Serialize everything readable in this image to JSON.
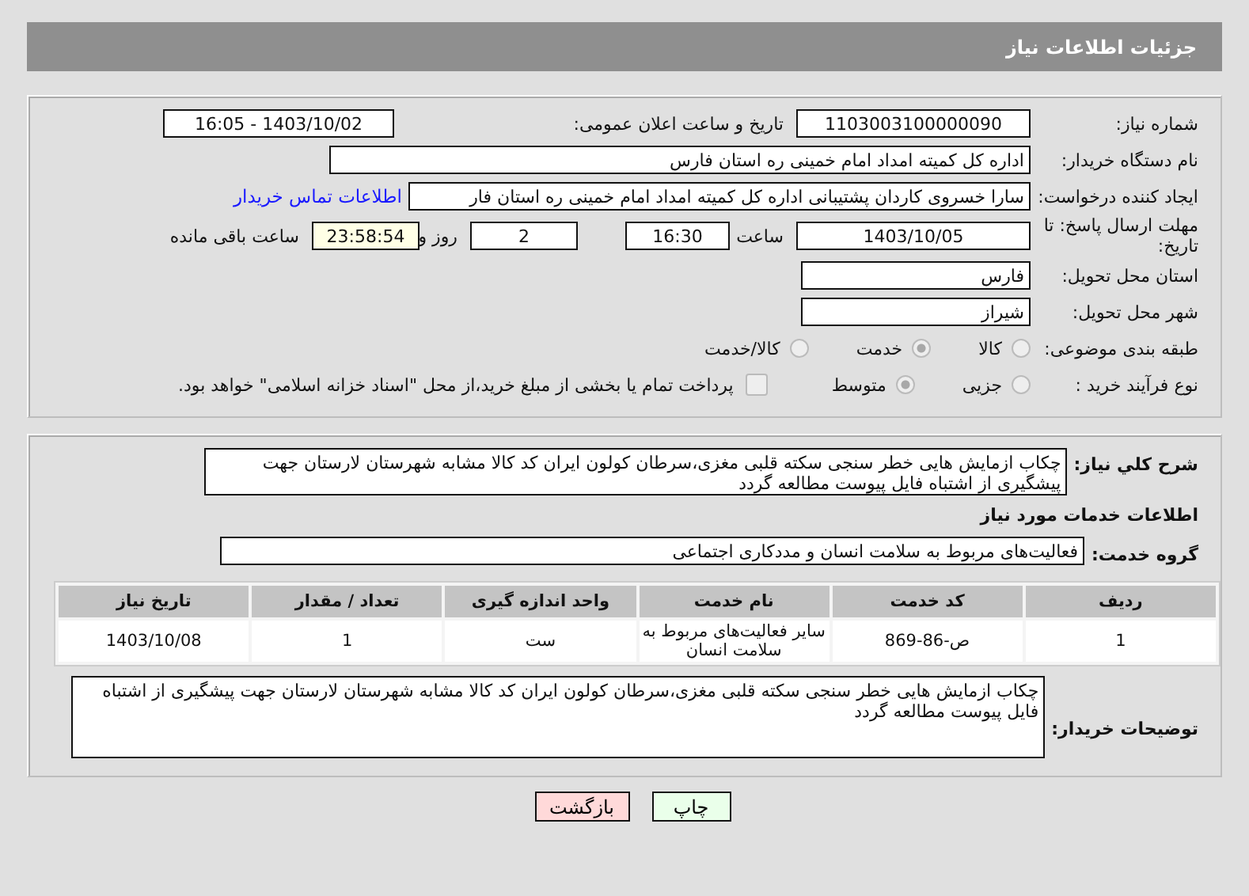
{
  "header": {
    "title": "جزئیات اطلاعات نیاز"
  },
  "need_number": {
    "label": "شماره نیاز:",
    "value": "1103003100000090"
  },
  "announce_datetime": {
    "label": "تاریخ و ساعت اعلان عمومی:",
    "value": "1403/10/02 - 16:05"
  },
  "buyer_org": {
    "label": "نام دستگاه خریدار:",
    "value": "اداره کل کمیته امداد امام خمینی  ره  استان فارس"
  },
  "requester": {
    "label": "ایجاد کننده درخواست:",
    "value": "سارا خسروی کاردان پشتیبانی  اداره کل کمیته امداد امام خمینی  ره  استان فار",
    "link": "اطلاعات تماس خریدار"
  },
  "deadline": {
    "label": "مهلت ارسال پاسخ: تا تاریخ:",
    "date": "1403/10/05",
    "time_label": "ساعت",
    "time": "16:30",
    "days": "2",
    "days_label": "روز و",
    "remaining": "23:58:54",
    "remaining_label": "ساعت باقی مانده"
  },
  "delivery_province": {
    "label": "استان محل تحویل:",
    "value": "فارس"
  },
  "delivery_city": {
    "label": "شهر محل تحویل:",
    "value": "شیراز"
  },
  "category": {
    "label": "طبقه بندی موضوعی:",
    "options": [
      {
        "label": "کالا",
        "selected": false
      },
      {
        "label": "خدمت",
        "selected": true
      },
      {
        "label": "کالا/خدمت",
        "selected": false
      }
    ]
  },
  "process_type": {
    "label": "نوع فرآیند خرید :",
    "options": [
      {
        "label": "جزیی",
        "selected": false
      },
      {
        "label": "متوسط",
        "selected": true
      }
    ],
    "payment_checkbox": {
      "label": "پرداخت تمام یا بخشی از مبلغ خرید،از محل \"اسناد خزانه اسلامی\" خواهد بود.",
      "checked": false
    }
  },
  "description": {
    "label": "شرح کلي نياز:",
    "value": "چکاب ازمایش هایی خطر سنجی سکته قلبی مغزی،سرطان کولون  ایران کد کالا مشابه شهرستان لارستان جهت پیشگیری از اشتباه فایل پیوست مطالعه گردد"
  },
  "services_heading": "اطلاعات خدمات مورد نیاز",
  "service_group": {
    "label": "گروه خدمت:",
    "value": "فعالیت‌های مربوط به سلامت انسان و مددکاری اجتماعی"
  },
  "table": {
    "columns": [
      "ردیف",
      "کد خدمت",
      "نام خدمت",
      "واحد اندازه گیری",
      "تعداد / مقدار",
      "تاریخ نیاز"
    ],
    "rows": [
      [
        "1",
        "ص-86-869",
        "سایر فعالیت‌های مربوط به سلامت انسان",
        "ست",
        "1",
        "1403/10/08"
      ]
    ]
  },
  "buyer_notes": {
    "label": "توضیحات خریدار:",
    "value": "چکاب ازمایش هایی خطر سنجی سکته قلبی مغزی،سرطان کولون  ایران کد کالا مشابه شهرستان لارستان  جهت پیشگیری از اشتباه فایل پیوست مطالعه گردد"
  },
  "buttons": [
    {
      "label": "چاپ",
      "kind": "print"
    },
    {
      "label": "بازگشت",
      "kind": "back"
    }
  ]
}
